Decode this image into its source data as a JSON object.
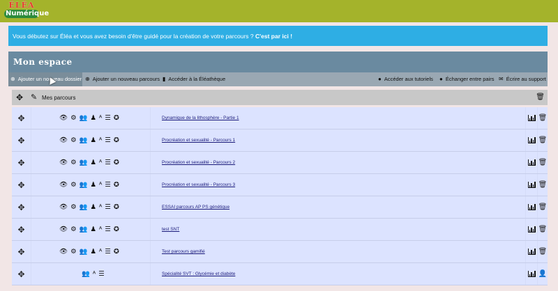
{
  "logo": {
    "line1": "ÉLÉA",
    "line2": "Numérique"
  },
  "notice": {
    "text": "Vous débutez sur Éléa et vous avez besoin d'être guidé pour la création de votre parcours ? ",
    "link": "C'est par ici !"
  },
  "space": {
    "title": "Mon espace"
  },
  "actions": {
    "add_folder": "Ajouter un nouveau dossier",
    "add_course": "Ajouter un nouveau parcours",
    "library": "Accéder à la Éléathèque",
    "tutorials": "Accéder aux tutoriels",
    "peers": "Échanger entre pairs",
    "support": "Écrire au support"
  },
  "parcours_header": {
    "label": "Mes parcours"
  },
  "icons": {
    "move": "✥",
    "edit": "✎",
    "trash": "🗑",
    "eye": "👁",
    "gears": "⚙",
    "group": "👥",
    "person": "👤",
    "translate": "ᴬ",
    "list": "☰",
    "badge": "✪",
    "info": "❶",
    "peers": "❷",
    "mail": "✉",
    "book": "▮",
    "plus": "⊕"
  },
  "rows": [
    {
      "title": "Dynamique de la lithosphère - Partie 1",
      "full": true
    },
    {
      "title": "Procréation et sexualité - Parcours 1",
      "full": true
    },
    {
      "title": "Procréation et sexualité - Parcours 2",
      "full": true
    },
    {
      "title": "Procréation et sexualité - Parcours 3",
      "full": true
    },
    {
      "title": "ESSAI parcours AP PS génétique",
      "full": true
    },
    {
      "title": "test SNT",
      "full": true
    },
    {
      "title": "Test parcours gamifié",
      "full": true
    },
    {
      "title": "Spécialité SVT : Glycémie et diabète",
      "full": false
    }
  ]
}
